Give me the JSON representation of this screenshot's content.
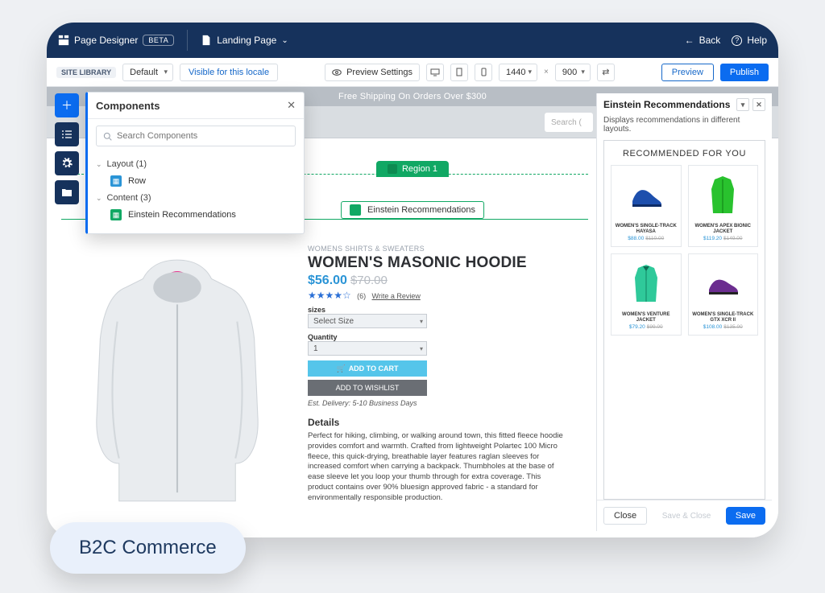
{
  "topbar": {
    "page_designer": "Page Designer",
    "beta": "BETA",
    "landing_page": "Landing Page",
    "back": "Back",
    "help": "Help"
  },
  "toolbar": {
    "site_library": "SITE LIBRARY",
    "default": "Default",
    "visible": "Visible for this locale",
    "preview_settings": "Preview Settings",
    "width": "1440",
    "height": "900",
    "preview": "Preview",
    "publish": "Publish"
  },
  "components_panel": {
    "title": "Components",
    "search_placeholder": "Search Components",
    "group_layout": "Layout (1)",
    "item_row": "Row",
    "group_content": "Content (3)",
    "item_einstein": "Einstein Recommendations"
  },
  "canvas": {
    "banner": "Free Shipping On Orders Over $300",
    "search": "Search (",
    "region": "Region 1",
    "einstein_chip": "Einstein Recommendations"
  },
  "product": {
    "breadcrumb": "WOMENS SHIRTS & SWEATERS",
    "title": "WOMEN'S MASONIC HOODIE",
    "price": "$56.00",
    "price_old": "$70.00",
    "review_count": "(6)",
    "write_review": "Write a Review",
    "sizes_label": "sizes",
    "select_size": "Select Size",
    "qty_label": "Quantity",
    "qty_value": "1",
    "add_to_cart": "ADD TO CART",
    "add_to_wishlist": "ADD TO WISHLIST",
    "delivery": "Est. Delivery: 5-10 Business Days",
    "details_h": "Details",
    "details_p": "Perfect for hiking, climbing, or walking around town, this fitted fleece hoodie provides comfort and warmth. Crafted from lightweight Polartec 100 Micro fleece, this quick-drying, breathable layer features raglan sleeves for increased comfort when carrying a backpack. Thumbholes at the base of ease sleeve let you loop your thumb through for extra coverage. This product contains over 90% bluesign approved fabric - a standard for environmentally responsible production."
  },
  "right_panel": {
    "title": "Einstein Recommendations",
    "subtitle": "Displays recommendations in different layouts.",
    "rec_heading": "RECOMMENDED FOR YOU",
    "items": [
      {
        "name": "WOMEN'S SINGLE-TRACK HAYASA",
        "price": "$88.00",
        "old": "$110.00"
      },
      {
        "name": "WOMEN'S APEX BIONIC JACKET",
        "price": "$119.20",
        "old": "$149.00"
      },
      {
        "name": "WOMEN'S VENTURE JACKET",
        "price": "$79.20",
        "old": "$99.00"
      },
      {
        "name": "WOMEN'S SINGLE-TRACK GTX XCR II",
        "price": "$108.00",
        "old": "$135.00"
      }
    ],
    "close": "Close",
    "save_close": "Save & Close",
    "save": "Save"
  },
  "pill": "B2C Commerce"
}
